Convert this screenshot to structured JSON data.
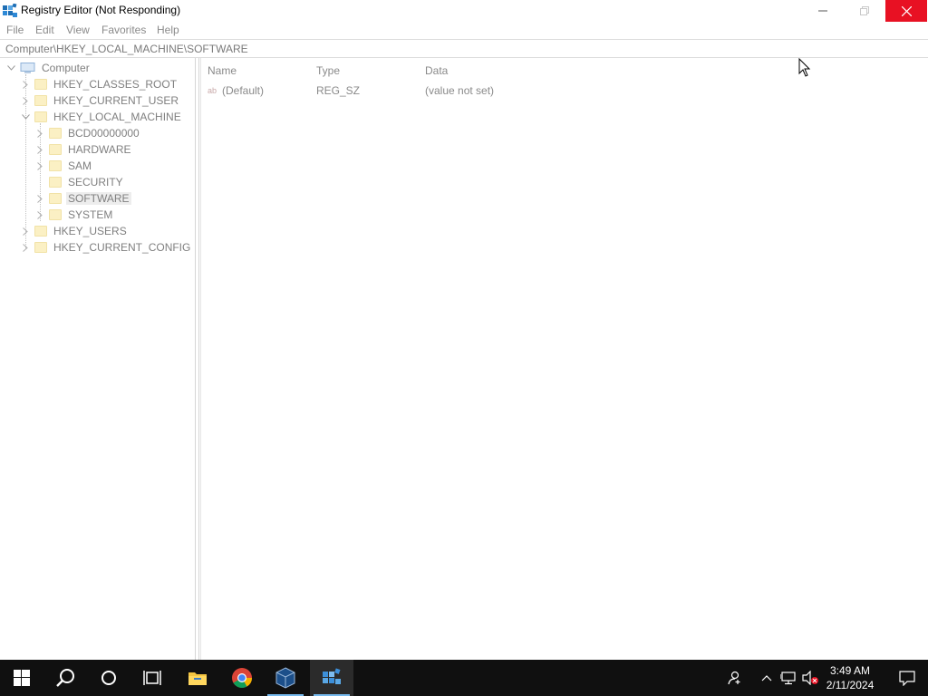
{
  "window": {
    "title": "Registry Editor (Not Responding)",
    "close_color": "#e81123"
  },
  "menu": {
    "items": [
      "File",
      "Edit",
      "View",
      "Favorites",
      "Help"
    ]
  },
  "address": {
    "path": "Computer\\HKEY_LOCAL_MACHINE\\SOFTWARE"
  },
  "tree": {
    "root": "Computer",
    "hives": {
      "classes_root": "HKEY_CLASSES_ROOT",
      "current_user": "HKEY_CURRENT_USER",
      "local_machine": "HKEY_LOCAL_MACHINE",
      "users": "HKEY_USERS",
      "current_config": "HKEY_CURRENT_CONFIG"
    },
    "local_machine_children": [
      "BCD00000000",
      "HARDWARE",
      "SAM",
      "SECURITY",
      "SOFTWARE",
      "SYSTEM"
    ],
    "selected": "SOFTWARE"
  },
  "list": {
    "columns": [
      "Name",
      "Type",
      "Data"
    ],
    "rows": [
      {
        "name": "(Default)",
        "type": "REG_SZ",
        "data": "(value not set)",
        "icon": "string-value-icon"
      }
    ]
  },
  "taskbar": {
    "apps": [
      "start-icon",
      "search-icon",
      "cortana-icon",
      "task-view-icon",
      "file-explorer-icon",
      "chrome-icon",
      "virtualbox-icon",
      "regedit-icon"
    ],
    "active_app": "regedit-icon",
    "accent": "#76b9ed"
  },
  "clock": {
    "time": "3:49 AM",
    "date": "2/11/2024"
  }
}
